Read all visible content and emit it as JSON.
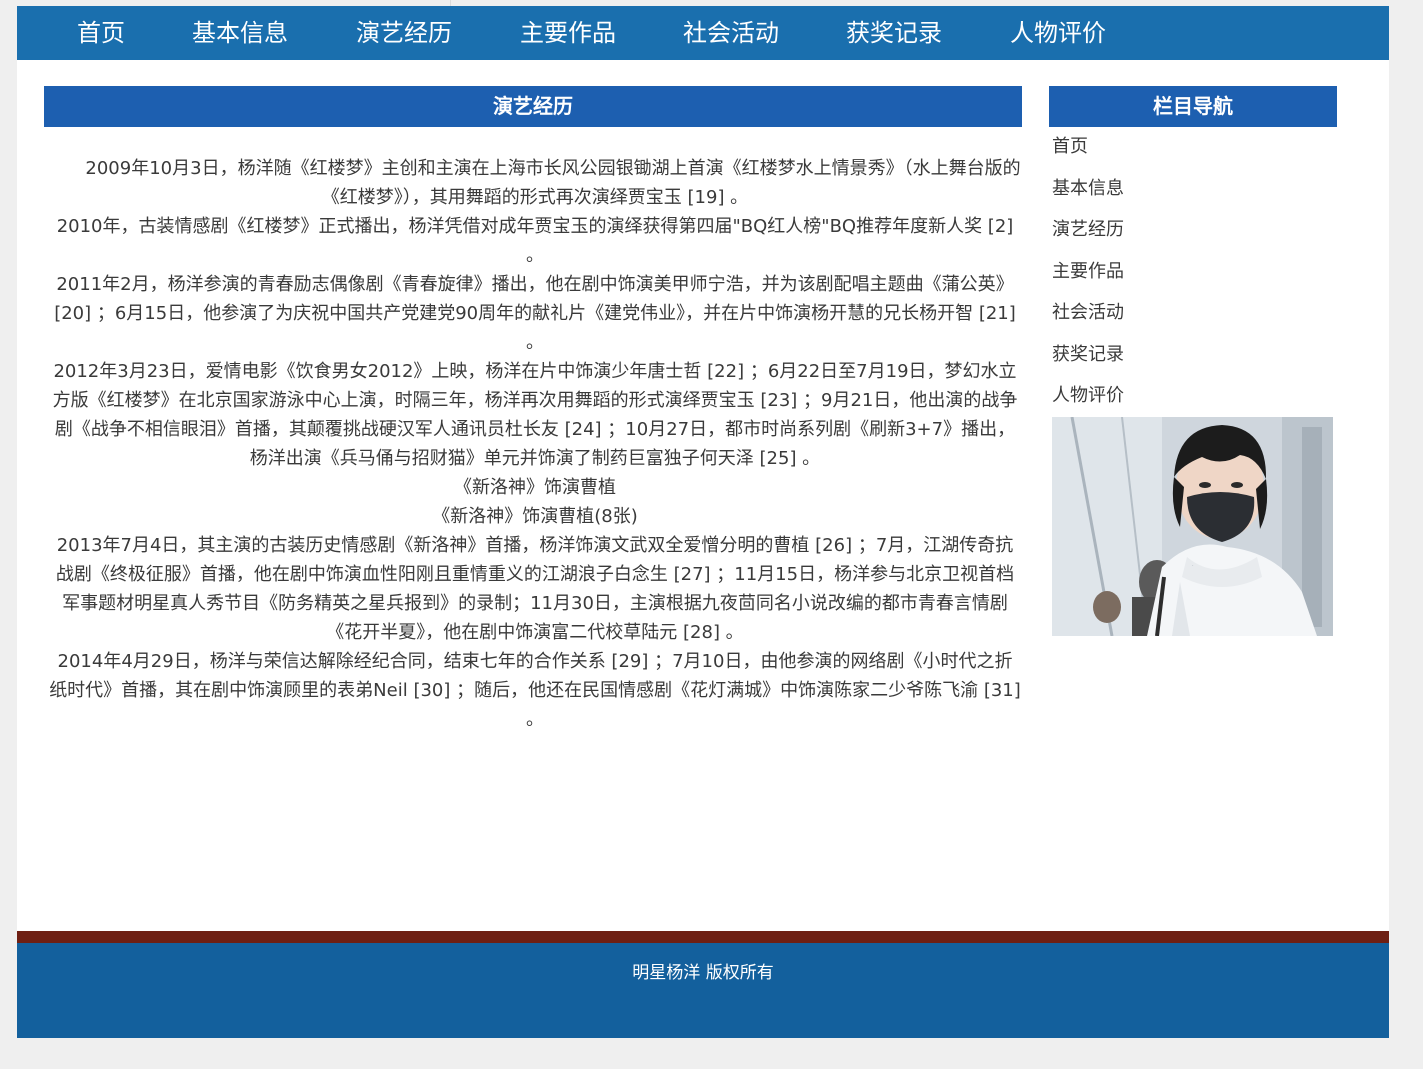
{
  "nav": {
    "items": [
      {
        "label": "首页"
      },
      {
        "label": "基本信息"
      },
      {
        "label": "演艺经历"
      },
      {
        "label": "主要作品"
      },
      {
        "label": "社会活动"
      },
      {
        "label": "获奖记录"
      },
      {
        "label": "人物评价"
      }
    ]
  },
  "main": {
    "title": "演艺经历",
    "paragraphs": [
      "2009年10月3日，杨洋随《红楼梦》主创和主演在上海市长风公园银锄湖上首演《红楼梦水上情景秀》（水上舞台版的《红楼梦》），其用舞蹈的形式再次演绎贾宝玉 [19] 。",
      "2010年，古装情感剧《红楼梦》正式播出，杨洋凭借对成年贾宝玉的演绎获得第四届\"BQ红人榜\"BQ推荐年度新人奖 [2] 。",
      "2011年2月，杨洋参演的青春励志偶像剧《青春旋律》播出，他在剧中饰演美甲师宁浩，并为该剧配唱主题曲《蒲公英》 [20] ；6月15日，他参演了为庆祝中国共产党建党90周年的献礼片《建党伟业》，并在片中饰演杨开慧的兄长杨开智 [21] 。",
      "2012年3月23日，爱情电影《饮食男女2012》上映，杨洋在片中饰演少年唐士哲 [22] ；6月22日至7月19日，梦幻水立方版《红楼梦》在北京国家游泳中心上演，时隔三年，杨洋再次用舞蹈的形式演绎贾宝玉 [23] ；9月21日，他出演的战争剧《战争不相信眼泪》首播，其颠覆挑战硬汉军人通讯员杜长友 [24] ；10月27日，都市时尚系列剧《刷新3+7》播出，杨洋出演《兵马俑与招财猫》单元并饰演了制药巨富独子何天泽 [25] 。",
      "《新洛神》饰演曹植",
      "《新洛神》饰演曹植(8张)",
      "2013年7月4日，其主演的古装历史情感剧《新洛神》首播，杨洋饰演文武双全爱憎分明的曹植 [26] ；7月，江湖传奇抗战剧《终极征服》首播，他在剧中饰演血性阳刚且重情重义的江湖浪子白念生 [27] ；11月15日，杨洋参与北京卫视首档军事题材明星真人秀节目《防务精英之星兵报到》的录制；11月30日，主演根据九夜茴同名小说改编的都市青春言情剧《花开半夏》，他在剧中饰演富二代校草陆元 [28] 。",
      "2014年4月29日，杨洋与荣信达解除经纪合同，结束七年的合作关系 [29] ；7月10日，由他参演的网络剧《小时代之折纸时代》首播，其在剧中饰演顾里的表弟Neil [30] ；随后，他还在民国情感剧《花灯满城》中饰演陈家二少爷陈飞渝 [31] 。"
    ]
  },
  "sidebar": {
    "title": "栏目导航",
    "items": [
      {
        "label": "首页"
      },
      {
        "label": "基本信息"
      },
      {
        "label": "演艺经历"
      },
      {
        "label": "主要作品"
      },
      {
        "label": "社会活动"
      },
      {
        "label": "获奖记录"
      },
      {
        "label": "人物评价"
      }
    ],
    "photo_watermark": "·"
  },
  "footer": {
    "text": "明星杨洋 版权所有"
  },
  "colors": {
    "nav_bg": "#1a6fae",
    "header_bg": "#1d5fb0",
    "footer_bar": "#6e1f13",
    "footer_bg": "#13609d"
  }
}
